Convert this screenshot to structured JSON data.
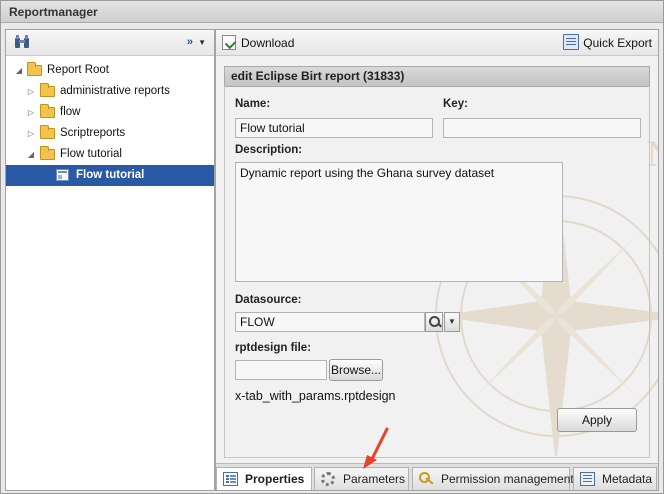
{
  "window": {
    "title": "Reportmanager"
  },
  "tree": {
    "items": [
      {
        "label": "Report Root",
        "depth": 0,
        "expanded": true,
        "icon": "folder-open-icon"
      },
      {
        "label": "administrative reports",
        "depth": 1,
        "expanded": false,
        "icon": "folder-icon"
      },
      {
        "label": "flow",
        "depth": 1,
        "expanded": false,
        "icon": "folder-icon"
      },
      {
        "label": "Scriptreports",
        "depth": 1,
        "expanded": false,
        "icon": "folder-icon"
      },
      {
        "label": "Flow tutorial",
        "depth": 1,
        "expanded": true,
        "icon": "folder-open-icon"
      },
      {
        "label": "Flow tutorial",
        "depth": 2,
        "selected": true,
        "icon": "report-icon"
      }
    ],
    "more_label": "››"
  },
  "toolbar": {
    "download_label": "Download",
    "quick_export_label": "Quick Export"
  },
  "editor": {
    "header": "edit Eclipse Birt report (31833)",
    "name_label": "Name:",
    "name_value": "Flow tutorial",
    "key_label": "Key:",
    "key_value": "",
    "description_label": "Description:",
    "description_value": "Dynamic report using the Ghana survey dataset",
    "datasource_label": "Datasource:",
    "datasource_value": "FLOW",
    "rptdesign_label": "rptdesign file:",
    "browse_label": "Browse...",
    "file_name": "x-tab_with_params.rptdesign",
    "apply_label": "Apply"
  },
  "tabs": [
    {
      "label": "Properties",
      "active": true,
      "icon": "properties-icon"
    },
    {
      "label": "Parameters",
      "active": false,
      "icon": "gear-icon"
    },
    {
      "label": "Permission management",
      "active": false,
      "icon": "key-icon"
    },
    {
      "label": "Metadata",
      "active": false,
      "icon": "metadata-icon"
    }
  ],
  "colors": {
    "selection": "#2a5aa6",
    "annotation_arrow": "#e8412c"
  }
}
